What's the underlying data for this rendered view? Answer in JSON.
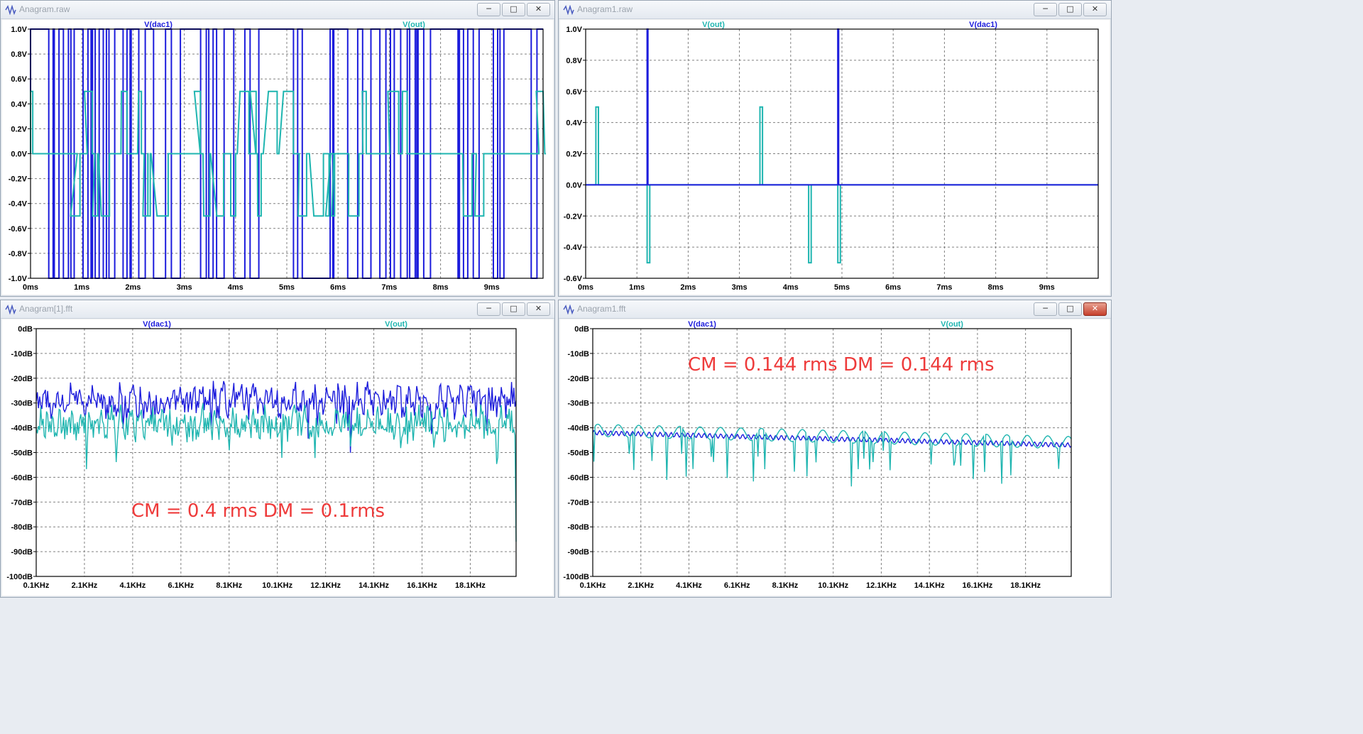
{
  "windows": [
    {
      "id": "w1",
      "title": "Anagram.raw",
      "close_style": "normal",
      "chart_data": {
        "type": "line",
        "title": "",
        "xlabel": "",
        "ylabel": "",
        "xlim": [
          0,
          10
        ],
        "ylim": [
          -1.0,
          1.0
        ],
        "grid": true,
        "legend": [
          "V(dac1)",
          "V(out)"
        ],
        "series_colors": [
          "#1c1cdc",
          "#1fb5b0"
        ],
        "x_ticks": [
          "0ms",
          "1ms",
          "2ms",
          "3ms",
          "4ms",
          "5ms",
          "6ms",
          "7ms",
          "8ms",
          "9ms"
        ],
        "y_ticks": [
          "1.0V",
          "0.8V",
          "0.6V",
          "0.4V",
          "0.2V",
          "0.0V",
          "-0.2V",
          "-0.4V",
          "-0.6V",
          "-0.8V",
          "-1.0V"
        ],
        "series": [
          {
            "name": "V(dac1)",
            "kind": "random-pulses",
            "levels": [
              -1,
              0,
              1
            ],
            "density": "high"
          },
          {
            "name": "V(out)",
            "kind": "random-pulses",
            "levels": [
              -0.5,
              0,
              0.5
            ],
            "density": "medium"
          }
        ]
      }
    },
    {
      "id": "w2",
      "title": "Anagram1.raw",
      "close_style": "normal",
      "chart_data": {
        "type": "line",
        "title": "",
        "xlabel": "",
        "ylabel": "",
        "xlim": [
          0,
          10
        ],
        "ylim": [
          -0.6,
          1.0
        ],
        "grid": true,
        "legend": [
          "V(out)",
          "V(dac1)"
        ],
        "series_colors": [
          "#1fb5b0",
          "#1c1cdc"
        ],
        "x_ticks": [
          "0ms",
          "1ms",
          "2ms",
          "3ms",
          "4ms",
          "5ms",
          "6ms",
          "7ms",
          "8ms",
          "9ms"
        ],
        "y_ticks": [
          "1.0V",
          "0.8V",
          "0.6V",
          "0.4V",
          "0.2V",
          "0.0V",
          "-0.2V",
          "-0.4V",
          "-0.6V"
        ],
        "series": [
          {
            "name": "V(out)",
            "pulses": [
              [
                0.2,
                0.5
              ],
              [
                1.2,
                -0.5
              ],
              [
                3.4,
                0.5
              ],
              [
                4.35,
                -0.5
              ],
              [
                4.92,
                -0.5
              ]
            ]
          },
          {
            "name": "V(dac1)",
            "pulses": [
              [
                1.2,
                1.0
              ],
              [
                4.92,
                1.0
              ]
            ]
          }
        ]
      }
    },
    {
      "id": "w3",
      "title": "Anagram[1].fft",
      "close_style": "normal",
      "annotation": "CM = 0.4 rms DM = 0.1rms",
      "chart_data": {
        "type": "line",
        "title": "",
        "xlabel": "",
        "ylabel": "",
        "xlim": [
          0.1,
          20
        ],
        "ylim": [
          -100,
          0
        ],
        "grid": true,
        "legend": [
          "V(dac1)",
          "V(out)"
        ],
        "series_colors": [
          "#1c1cdc",
          "#1fb5b0"
        ],
        "x_ticks": [
          "0.1KHz",
          "2.1KHz",
          "4.1KHz",
          "6.1KHz",
          "8.1KHz",
          "10.1KHz",
          "12.1KHz",
          "14.1KHz",
          "16.1KHz",
          "18.1KHz"
        ],
        "y_ticks": [
          "0dB",
          "-10dB",
          "-20dB",
          "-30dB",
          "-40dB",
          "-50dB",
          "-60dB",
          "-70dB",
          "-80dB",
          "-90dB",
          "-100dB"
        ],
        "series": [
          {
            "name": "V(dac1)",
            "kind": "noise-spectrum",
            "mean_db": -29,
            "spread_db": 6
          },
          {
            "name": "V(out)",
            "kind": "noise-spectrum",
            "mean_db": -38,
            "spread_db": 6
          }
        ]
      }
    },
    {
      "id": "w4",
      "title": "Anagram1.fft",
      "close_style": "red",
      "annotation": "CM = 0.144 rms DM = 0.144 rms",
      "chart_data": {
        "type": "line",
        "title": "",
        "xlabel": "",
        "ylabel": "",
        "xlim": [
          0.1,
          20
        ],
        "ylim": [
          -100,
          0
        ],
        "grid": true,
        "legend": [
          "V(dac1)",
          "V(out)"
        ],
        "series_colors": [
          "#1c1cdc",
          "#1fb5b0"
        ],
        "x_ticks": [
          "0.1KHz",
          "2.1KHz",
          "4.1KHz",
          "6.1KHz",
          "8.1KHz",
          "10.1KHz",
          "12.1KHz",
          "14.1KHz",
          "16.1KHz",
          "18.1KHz"
        ],
        "y_ticks": [
          "0dB",
          "-10dB",
          "-20dB",
          "-30dB",
          "-40dB",
          "-50dB",
          "-60dB",
          "-70dB",
          "-80dB",
          "-90dB",
          "-100dB"
        ],
        "series": [
          {
            "name": "V(dac1)",
            "kind": "ripple",
            "start_db": -42,
            "end_db": -47
          },
          {
            "name": "V(out)",
            "kind": "notched",
            "start_db": -41,
            "end_db": -46
          }
        ]
      }
    }
  ],
  "buttons": {
    "minimize": "─",
    "maximize": "□",
    "close": "✕"
  }
}
